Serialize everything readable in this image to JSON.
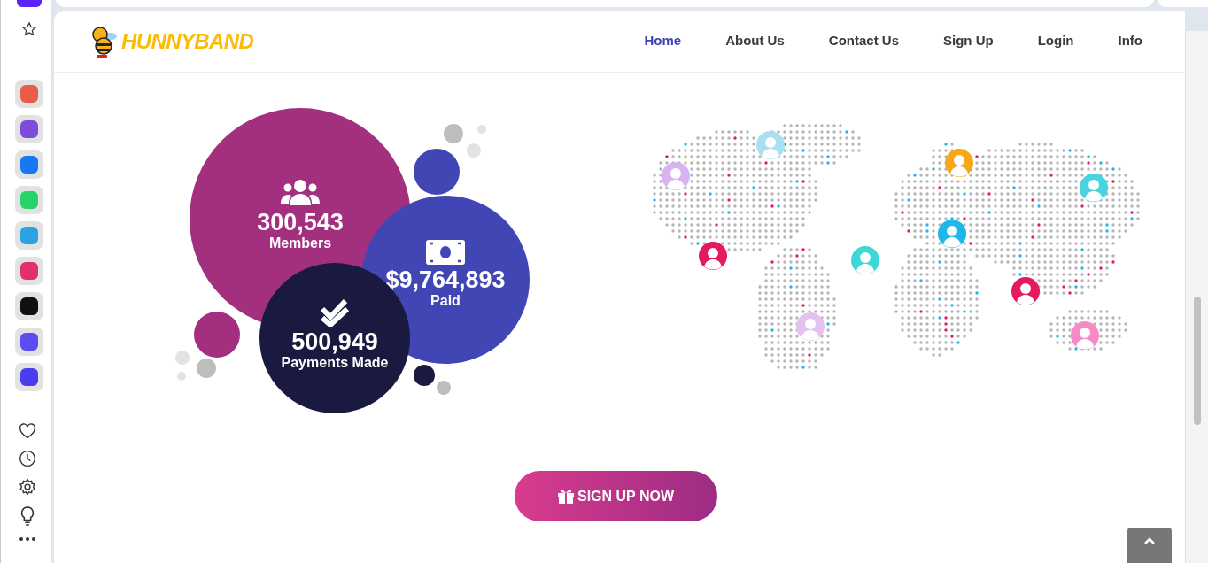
{
  "header": {
    "logo_text": "HUNNYBAND"
  },
  "nav": [
    {
      "label": "Home",
      "selected": true
    },
    {
      "label": "About Us",
      "selected": false
    },
    {
      "label": "Contact Us",
      "selected": false
    },
    {
      "label": "Sign Up",
      "selected": false
    },
    {
      "label": "Login",
      "selected": false
    },
    {
      "label": "Info",
      "selected": false
    }
  ],
  "stats": [
    {
      "kind": "members",
      "value": "300,543",
      "label": "Members"
    },
    {
      "kind": "paid",
      "value": "$9,764,893",
      "label": "Paid"
    },
    {
      "kind": "payments",
      "value": "500,949",
      "label": "Payments Made"
    }
  ],
  "cta": {
    "label": "SIGN UP NOW"
  }
}
